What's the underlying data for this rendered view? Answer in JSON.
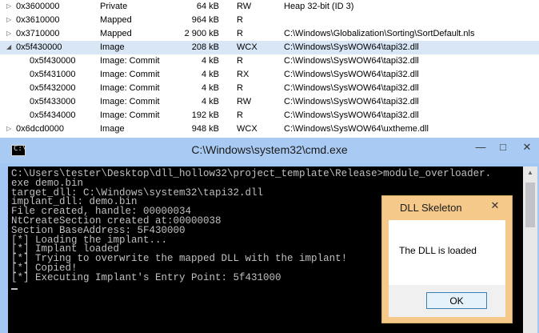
{
  "memory_map": {
    "rows": [
      {
        "arrow": "▷",
        "address": "0x3600000",
        "type": "Private",
        "size": "64 kB",
        "protection": "RW",
        "use": "Heap 32-bit (ID 3)",
        "child": false,
        "selected": false
      },
      {
        "arrow": "▷",
        "address": "0x3610000",
        "type": "Mapped",
        "size": "964 kB",
        "protection": "R",
        "use": "",
        "child": false,
        "selected": false
      },
      {
        "arrow": "▷",
        "address": "0x3710000",
        "type": "Mapped",
        "size": "2 900 kB",
        "protection": "R",
        "use": "C:\\Windows\\Globalization\\Sorting\\SortDefault.nls",
        "child": false,
        "selected": false
      },
      {
        "arrow": "◢",
        "address": "0x5f430000",
        "type": "Image",
        "size": "208 kB",
        "protection": "WCX",
        "use": "C:\\Windows\\SysWOW64\\tapi32.dll",
        "child": false,
        "selected": true
      },
      {
        "arrow": "",
        "address": "0x5f430000",
        "type": "Image: Commit",
        "size": "4 kB",
        "protection": "R",
        "use": "C:\\Windows\\SysWOW64\\tapi32.dll",
        "child": true,
        "selected": false
      },
      {
        "arrow": "",
        "address": "0x5f431000",
        "type": "Image: Commit",
        "size": "4 kB",
        "protection": "RX",
        "use": "C:\\Windows\\SysWOW64\\tapi32.dll",
        "child": true,
        "selected": false
      },
      {
        "arrow": "",
        "address": "0x5f432000",
        "type": "Image: Commit",
        "size": "4 kB",
        "protection": "R",
        "use": "C:\\Windows\\SysWOW64\\tapi32.dll",
        "child": true,
        "selected": false
      },
      {
        "arrow": "",
        "address": "0x5f433000",
        "type": "Image: Commit",
        "size": "4 kB",
        "protection": "RW",
        "use": "C:\\Windows\\SysWOW64\\tapi32.dll",
        "child": true,
        "selected": false
      },
      {
        "arrow": "",
        "address": "0x5f434000",
        "type": "Image: Commit",
        "size": "192 kB",
        "protection": "R",
        "use": "C:\\Windows\\SysWOW64\\tapi32.dll",
        "child": true,
        "selected": false
      },
      {
        "arrow": "▷",
        "address": "0x6dcd0000",
        "type": "Image",
        "size": "948 kB",
        "protection": "WCX",
        "use": "C:\\Windows\\SysWOW64\\uxtheme.dll",
        "child": false,
        "selected": false
      }
    ]
  },
  "cmd": {
    "icon_glyph": "C:\\",
    "title": "C:\\Windows\\system32\\cmd.exe",
    "minimize": "—",
    "maximize": "□",
    "close": "✕",
    "lines": [
      "C:\\Users\\tester\\Desktop\\dll_hollow32\\project_template\\Release>module_overloader.",
      "exe demo.bin",
      "target_dll: C:\\Windows\\system32\\tapi32.dll",
      "implant_dll: demo.bin",
      "File created, handle: 00000034",
      "NtCreateSection created at:00000038",
      "Section BaseAddress: 5F430000",
      "[*] Loading the implant...",
      "[*] Implant loaded",
      "[*] Trying to overwrite the mapped DLL with the implant!",
      "[*] Copied!",
      "[*] Executing Implant's Entry Point: 5f431000"
    ],
    "scroll_up": "▲"
  },
  "msgbox": {
    "title": "DLL Skeleton",
    "close": "✕",
    "text": "The DLL is loaded",
    "ok_label": "OK"
  }
}
